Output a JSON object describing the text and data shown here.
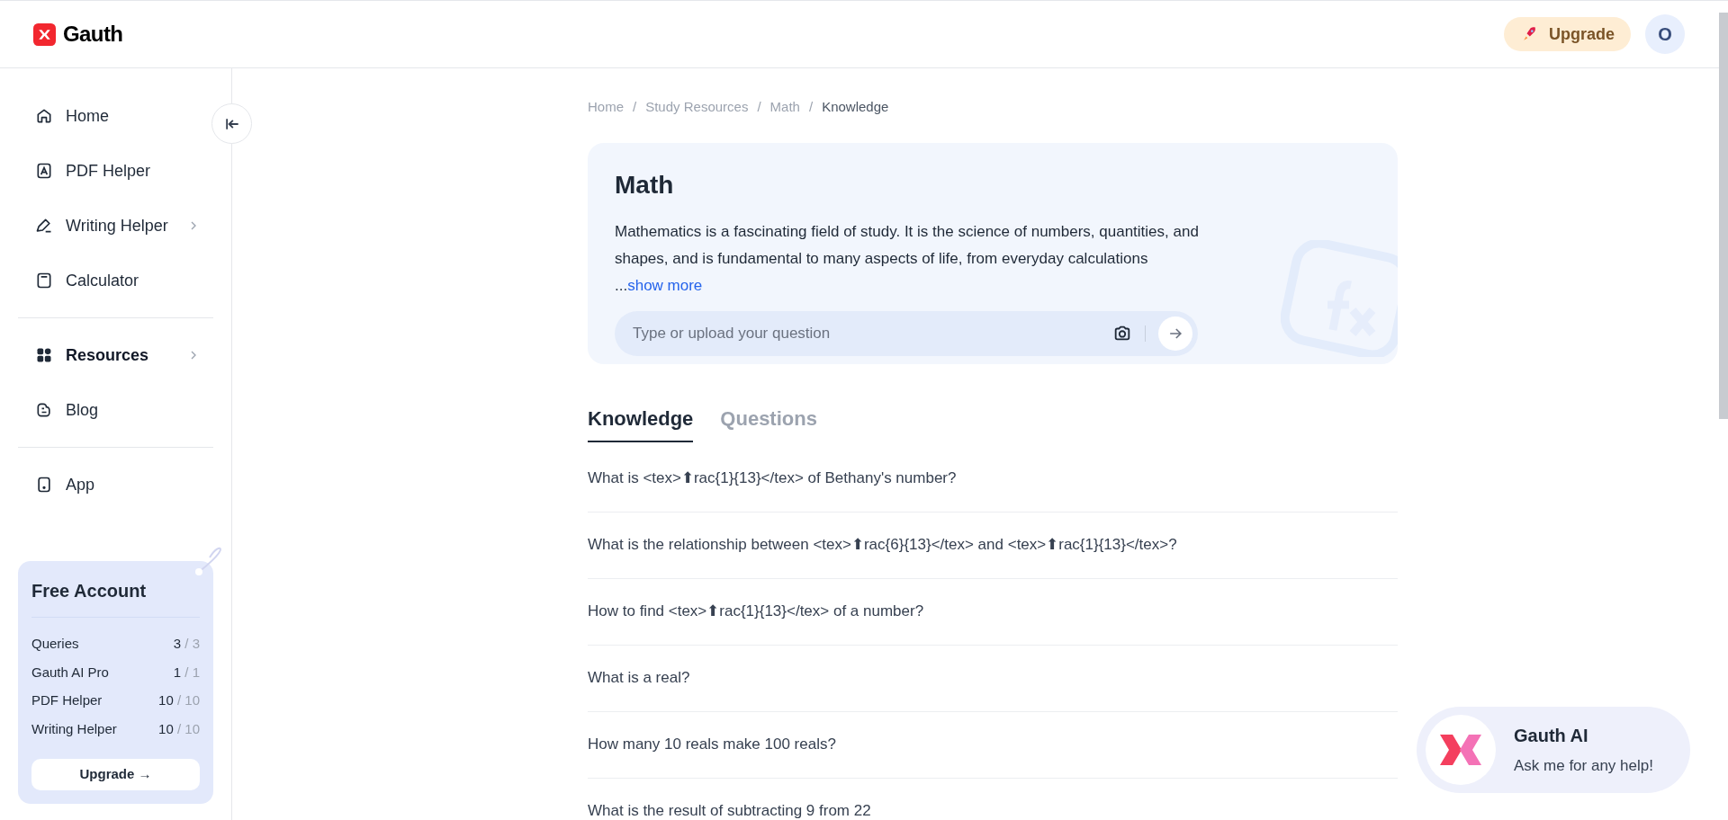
{
  "header": {
    "logo_text": "Gauth",
    "upgrade_button": "Upgrade",
    "avatar_letter": "O"
  },
  "sidebar": {
    "groups": [
      [
        {
          "label": "Home",
          "selected": false,
          "has_submenu": false
        },
        {
          "label": "PDF Helper",
          "selected": false,
          "has_submenu": false
        },
        {
          "label": "Writing Helper",
          "selected": false,
          "has_submenu": true
        },
        {
          "label": "Calculator",
          "selected": false,
          "has_submenu": false
        }
      ],
      [
        {
          "label": "Resources",
          "selected": true,
          "has_submenu": true
        },
        {
          "label": "Blog",
          "selected": false,
          "has_submenu": false
        }
      ],
      [
        {
          "label": "App",
          "selected": false,
          "has_submenu": false
        }
      ]
    ],
    "account_card": {
      "title": "Free Account",
      "quotas": [
        {
          "label": "Queries",
          "used": "3",
          "separator": "/",
          "total": "3"
        },
        {
          "label": "Gauth AI Pro",
          "used": "1",
          "separator": "/",
          "total": "1"
        },
        {
          "label": "PDF Helper",
          "used": "10",
          "separator": "/",
          "total": "10"
        },
        {
          "label": "Writing Helper",
          "used": "10",
          "separator": "/",
          "total": "10"
        }
      ],
      "button": "Upgrade →"
    }
  },
  "breadcrumb": [
    "Home",
    "Study Resources",
    "Math",
    "Knowledge"
  ],
  "breadcrumb_separator": "/",
  "hero": {
    "title": "Math",
    "description": "Mathematics is a fascinating field of study. It is the science of numbers, quantities, and shapes, and is fundamental to many aspects of life, from everyday calculations",
    "ellipsis": "...",
    "show_more": "show more",
    "search": {
      "placeholder": "Type or upload your question"
    }
  },
  "tabs": [
    {
      "label": "Knowledge",
      "selected": true
    },
    {
      "label": "Questions",
      "selected": false
    }
  ],
  "questions": [
    "What is <tex>⬆rac{1}{13}</tex> of Bethany's number?",
    "What is the relationship between <tex>⬆rac{6}{13}</tex> and <tex>⬆rac{1}{13}</tex>?",
    "How to find <tex>⬆rac{1}{13}</tex> of a number?",
    "What is a real?",
    "How many 10 reals make 100 reals?",
    "What is the result of subtracting 9 from 22"
  ],
  "chat_widget": {
    "title": "Gauth AI",
    "subtitle": "Ask me for any help!"
  }
}
